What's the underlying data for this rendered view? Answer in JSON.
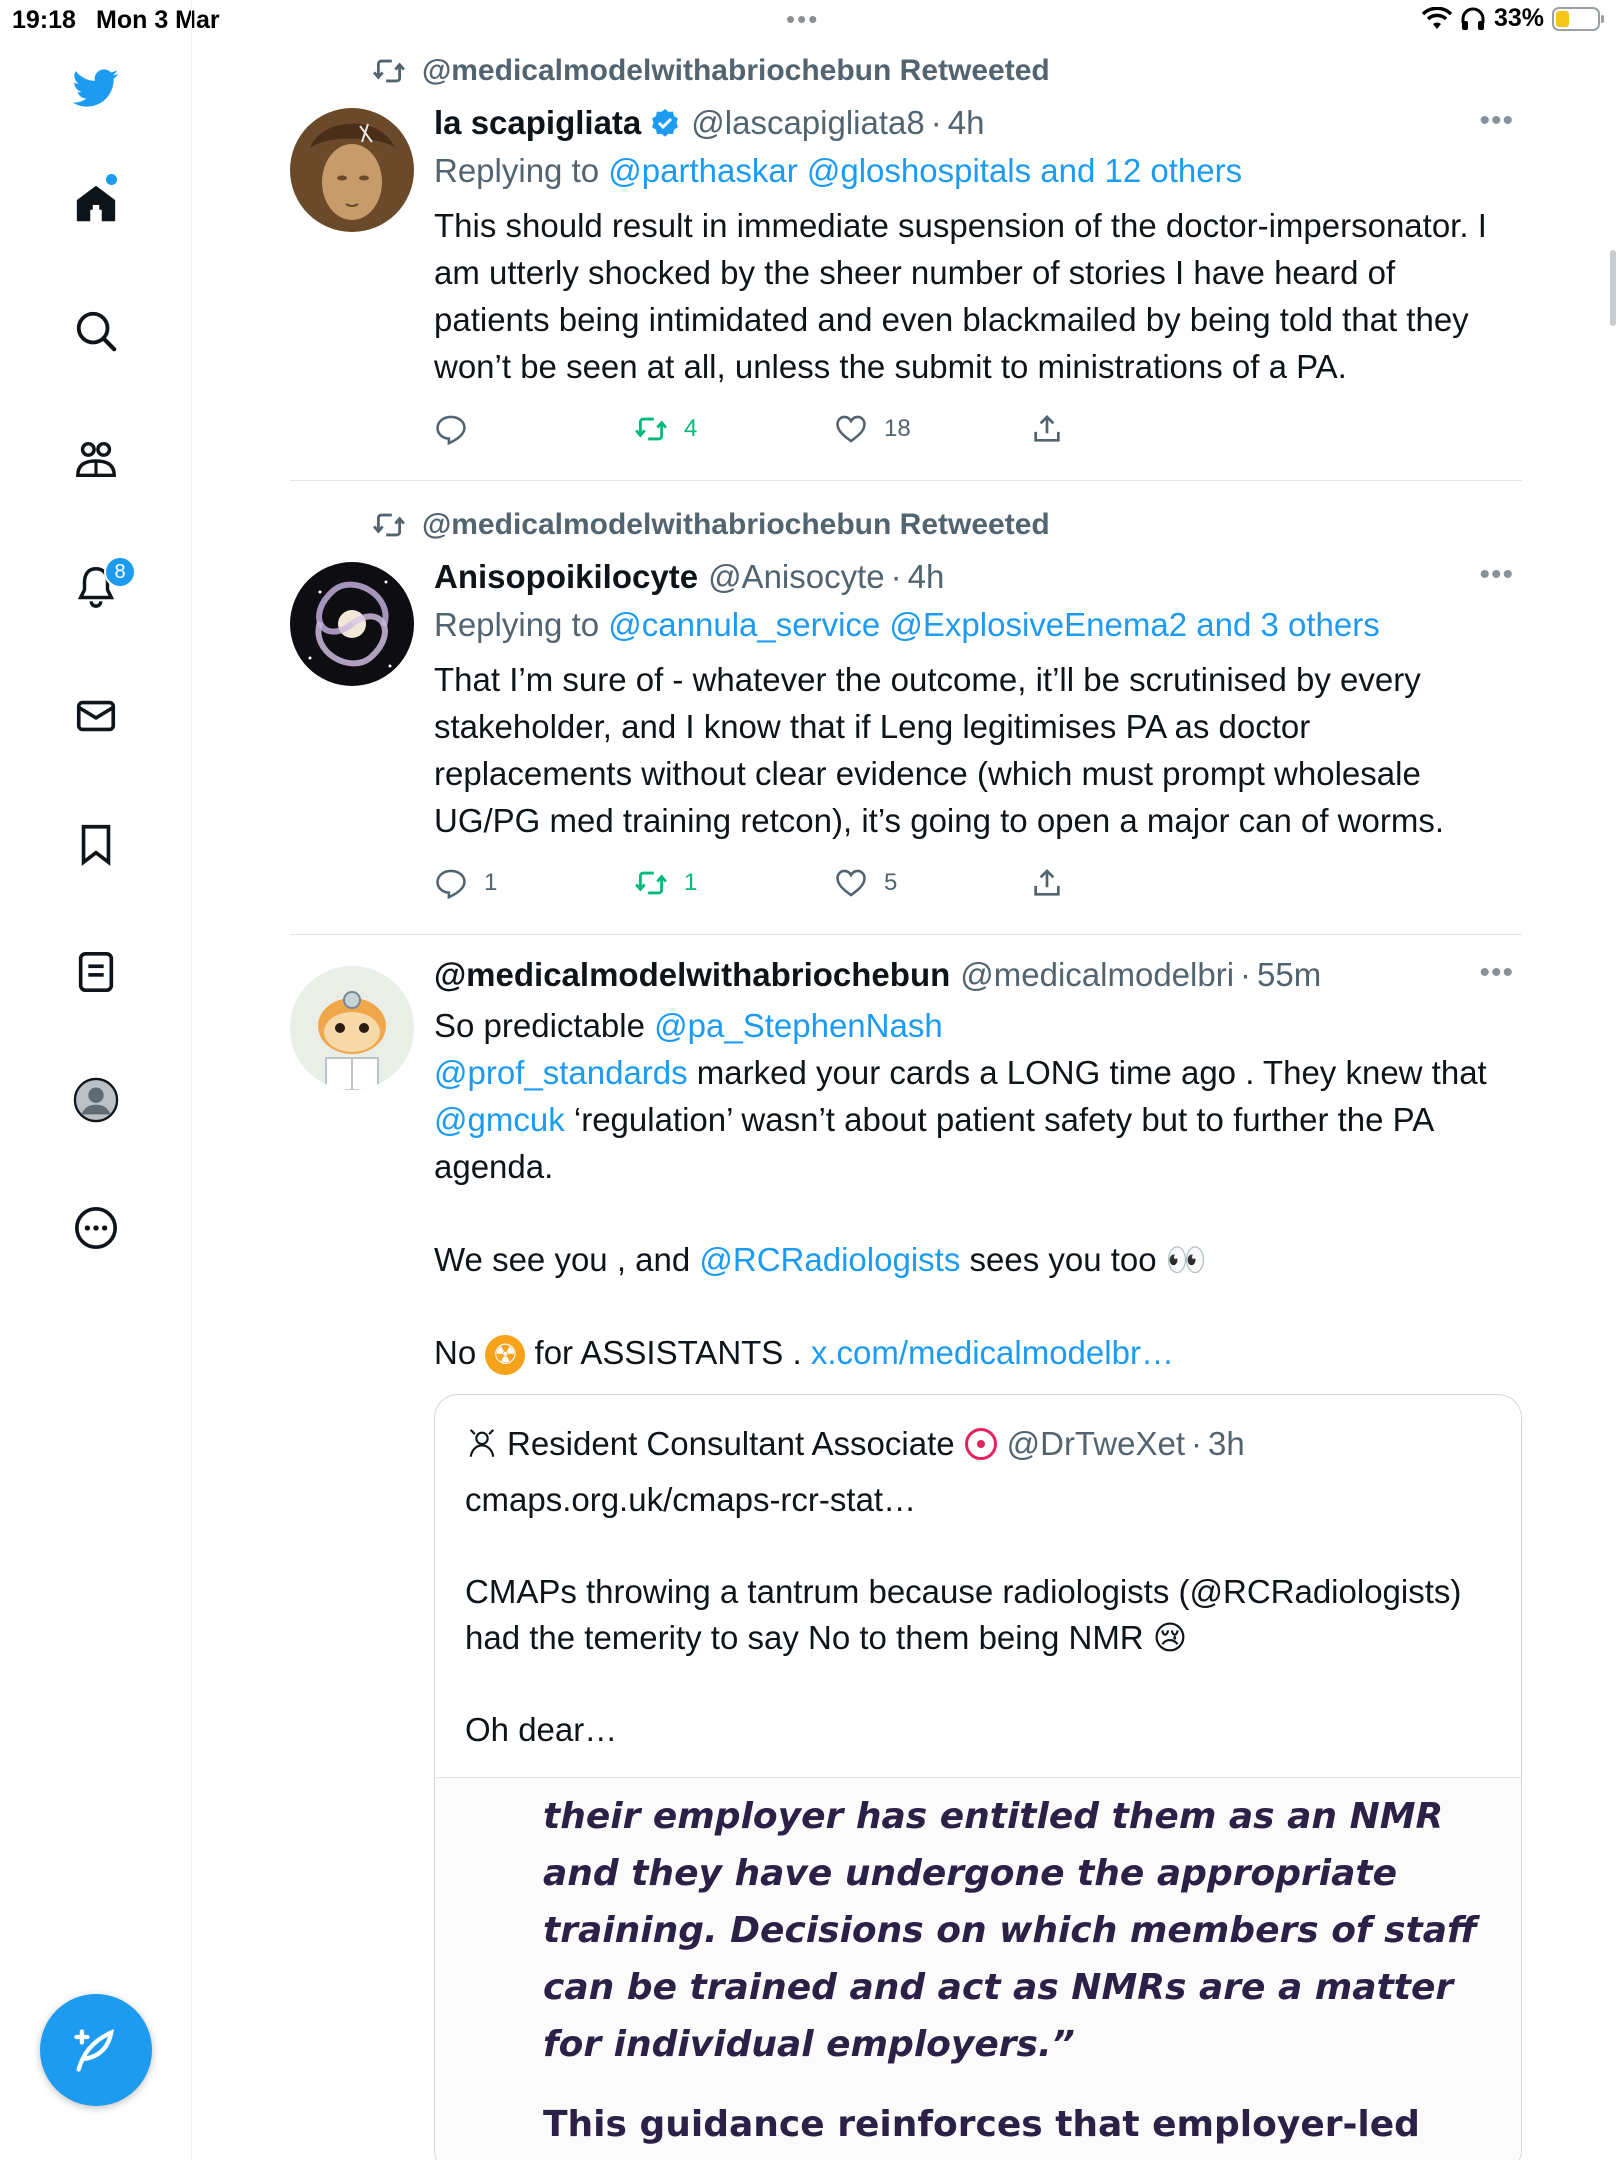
{
  "status_bar": {
    "time": "19:18",
    "date": "Mon 3 Mar",
    "battery": "33%",
    "battery_level": 0.33
  },
  "sidebar": {
    "items": [
      {
        "icon": "twitter-logo-icon"
      },
      {
        "icon": "home-icon"
      },
      {
        "icon": "search-icon"
      },
      {
        "icon": "communities-icon"
      },
      {
        "icon": "bell-icon",
        "badge": "8"
      },
      {
        "icon": "mail-icon"
      },
      {
        "icon": "bookmark-icon"
      },
      {
        "icon": "lists-icon"
      },
      {
        "icon": "profile-icon"
      },
      {
        "icon": "more-circle-icon"
      }
    ],
    "compose_icon": "compose-feather-icon"
  },
  "colors": {
    "accent": "#1d9bf0",
    "retweet_green": "#00ba7c",
    "muted": "#536471"
  },
  "tweets": [
    {
      "retweeted_by": "@medicalmodelwithabriochebun Retweeted",
      "name": "la scapigliata",
      "verified": true,
      "handle": "@lascapigliata8",
      "time": "4h",
      "replying_label": "Replying to",
      "replying_to": "@parthaskar @gloshospitals and 12 others",
      "body": "This should result in immediate suspension of the doctor-impersonator. I am utterly shocked by the sheer number of stories I have heard of patients being intimidated and even blackmailed by being told that they won’t be seen at all, unless the submit to ministrations of a PA.",
      "replies": "",
      "retweets": "4",
      "likes": "18"
    },
    {
      "retweeted_by": "@medicalmodelwithabriochebun Retweeted",
      "name": "Anisopoikilocyte",
      "verified": false,
      "handle": "@Anisocyte",
      "time": "4h",
      "replying_label": "Replying to",
      "replying_to": "@cannula_service @ExplosiveEnema2 and 3 others",
      "body": "That I’m sure of - whatever the outcome, it’ll be scrutinised by every stakeholder, and I know that if Leng legitimises PA as doctor replacements without clear evidence (which must prompt wholesale UG/PG med training retcon), it’s going to open a major can of worms.",
      "replies": "1",
      "retweets": "1",
      "likes": "5"
    },
    {
      "name": "@medicalmodelwithabriochebun",
      "handle": "@medicalmodelbri",
      "time": "55m",
      "body_parts": {
        "p1_text": "So predictable ",
        "p1_link": "@pa_StephenNash",
        "p2_link": "@prof_standards",
        "p2_text": " marked your cards a LONG time ago . They knew that ",
        "p3_link": "@gmcuk",
        "p3_text": " ‘regulation’ wasn’t about patient safety but to further the PA agenda.",
        "p4_text1": "We see you , and ",
        "p4_link": "@RCRadiologists",
        "p4_text2": " sees you too 👀",
        "p5_text1": "No ",
        "p5_emoji": "☢",
        "p5_text2": " for ASSISTANTS . ",
        "p5_link": "x.com/medicalmodelbr…"
      },
      "quote": {
        "name": "Resident Consultant Associate",
        "handle": "@DrTweXet",
        "time": "3h",
        "line1": "cmaps.org.uk/cmaps-rcr-stat…",
        "line2": "CMAPs throwing a tantrum because radiologists (@RCRadiologists) had the temerity to say No to them being NMR 😢",
        "line3": "Oh dear…",
        "image_text_1": "their employer has entitled them as an NMR and they have undergone the appropriate training. Decisions on which members of staff can be trained and act as NMRs are a matter for individual employers.”",
        "image_text_2": "This guidance reinforces that employer-led"
      }
    }
  ]
}
